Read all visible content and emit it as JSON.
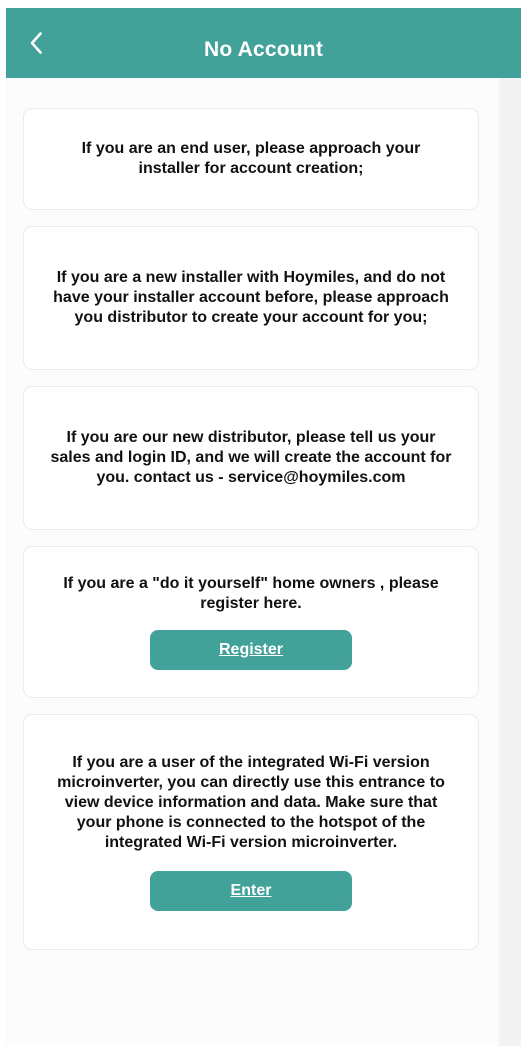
{
  "header": {
    "title": "No Account",
    "back_icon": "chevron-left-icon"
  },
  "colors": {
    "accent": "#42a199",
    "card_background": "#ffffff",
    "page_background": "#fcfcfc",
    "text": "#111111"
  },
  "cards": [
    {
      "text": "If you are an end user, please approach your installer for account creation;"
    },
    {
      "text": "If you are a new installer with Hoymiles, and do not have your installer account before, please approach you distributor to create your account for you;"
    },
    {
      "text": "If you are our new distributor, please tell us your sales and login ID, and we will create the account for you. contact us - service@hoymiles.com"
    },
    {
      "text": "If you are a \"do it yourself\" home owners , please register here.",
      "button_label": "Register"
    },
    {
      "text": "If you are a user of the integrated Wi-Fi version microinverter, you can directly use this entrance to view device information and data. Make sure that your phone is connected to the hotspot of the integrated Wi-Fi version microinverter.",
      "button_label": "Enter"
    }
  ]
}
